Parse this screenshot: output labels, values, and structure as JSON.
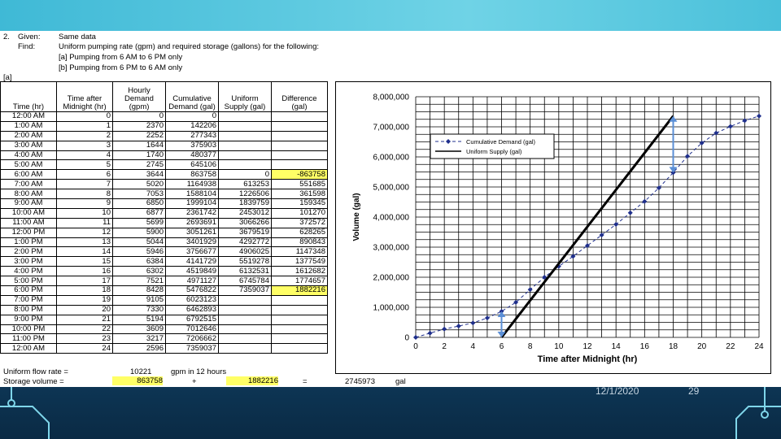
{
  "given": {
    "line1_num": "2.",
    "line1_label": "Given:",
    "line1_text": "Same data",
    "line2_label": "Find:",
    "line2_text": "Uniform pumping rate (gpm) and required storage (gallons) for the following:",
    "line3_text": "[a] Pumping from 6 AM to 6 PM only",
    "line4_text": "[b] Pumping from 6 PM to 6 AM only",
    "section_a": "[a]"
  },
  "table": {
    "headers": [
      "Time (hr)",
      "Time after Midnight (hr)",
      "Hourly Demand (gpm)",
      "Cumulative Demand (gal)",
      "Uniform Supply (gal)",
      "Difference (gal)"
    ],
    "rows": [
      [
        "12:00 AM",
        "0",
        "0",
        "0",
        "",
        ""
      ],
      [
        "1:00 AM",
        "1",
        "2370",
        "142206",
        "",
        ""
      ],
      [
        "2:00 AM",
        "2",
        "2252",
        "277343",
        "",
        ""
      ],
      [
        "3:00 AM",
        "3",
        "1644",
        "375903",
        "",
        ""
      ],
      [
        "4:00 AM",
        "4",
        "1740",
        "480377",
        "",
        ""
      ],
      [
        "5:00 AM",
        "5",
        "2745",
        "645106",
        "",
        ""
      ],
      [
        "6:00 AM",
        "6",
        "3644",
        "863758",
        "0",
        "-863758"
      ],
      [
        "7:00 AM",
        "7",
        "5020",
        "1164938",
        "613253",
        "551685"
      ],
      [
        "8:00 AM",
        "8",
        "7053",
        "1588104",
        "1226506",
        "361598"
      ],
      [
        "9:00 AM",
        "9",
        "6850",
        "1999104",
        "1839759",
        "159345"
      ],
      [
        "10:00 AM",
        "10",
        "6877",
        "2361742",
        "2453012",
        "101270"
      ],
      [
        "11:00 AM",
        "11",
        "5699",
        "2693691",
        "3066266",
        "372572"
      ],
      [
        "12:00 PM",
        "12",
        "5900",
        "3051261",
        "3679519",
        "628265"
      ],
      [
        "1:00 PM",
        "13",
        "5044",
        "3401929",
        "4292772",
        "890843"
      ],
      [
        "2:00 PM",
        "14",
        "5946",
        "3756677",
        "4906025",
        "1147348"
      ],
      [
        "3:00 PM",
        "15",
        "6384",
        "4141729",
        "5519278",
        "1377549"
      ],
      [
        "4:00 PM",
        "16",
        "6302",
        "4519849",
        "6132531",
        "1612682"
      ],
      [
        "5:00 PM",
        "17",
        "7521",
        "4971127",
        "6745784",
        "1774657"
      ],
      [
        "6:00 PM",
        "18",
        "8428",
        "5476822",
        "7359037",
        "1882216"
      ],
      [
        "7:00 PM",
        "19",
        "9105",
        "6023123",
        "",
        ""
      ],
      [
        "8:00 PM",
        "20",
        "7330",
        "6462893",
        "",
        ""
      ],
      [
        "9:00 PM",
        "21",
        "5194",
        "6792515",
        "",
        ""
      ],
      [
        "10:00 PM",
        "22",
        "3609",
        "7012646",
        "",
        ""
      ],
      [
        "11:00 PM",
        "23",
        "3217",
        "7206662",
        "",
        ""
      ],
      [
        "12:00 AM",
        "24",
        "2596",
        "7359037",
        "",
        ""
      ]
    ]
  },
  "footer": {
    "flow_label": "Uniform flow rate =",
    "flow_value": "10221",
    "flow_unit": "gpm in 12 hours",
    "storage_label": "Storage volume =",
    "storage_v1": "863758",
    "plus_sign": "+",
    "storage_v2": "1882216",
    "equals": "=",
    "storage_total": "2745973",
    "storage_unit": "gal"
  },
  "chart_data": {
    "type": "line",
    "xlabel": "Time after Midnight (hr)",
    "ylabel": "Volume (gal)",
    "xlim": [
      0,
      24
    ],
    "ylim": [
      0,
      8000000
    ],
    "xticks": [
      "0",
      "2",
      "4",
      "6",
      "8",
      "10",
      "12",
      "14",
      "16",
      "18",
      "20",
      "22",
      "24"
    ],
    "yticks": [
      "0",
      "1,000,000",
      "2,000,000",
      "3,000,000",
      "4,000,000",
      "5,000,000",
      "6,000,000",
      "7,000,000",
      "8,000,000"
    ],
    "grid": true,
    "legend_position": "center-right",
    "series": [
      {
        "name": "Cumulative Demand (gal)",
        "x": [
          0,
          1,
          2,
          3,
          4,
          5,
          6,
          7,
          8,
          9,
          10,
          11,
          12,
          13,
          14,
          15,
          16,
          17,
          18,
          19,
          20,
          21,
          22,
          23,
          24
        ],
        "y": [
          0,
          142206,
          277343,
          375903,
          480377,
          645106,
          863758,
          1164938,
          1588104,
          1999104,
          2361742,
          2693691,
          3051261,
          3401929,
          3756677,
          4141729,
          4519849,
          4971127,
          5476822,
          6023123,
          6462893,
          6792515,
          7012646,
          7206662,
          7359037
        ],
        "color": "#1f2f8c"
      },
      {
        "name": "Uniform Supply (gal)",
        "x": [
          6,
          18
        ],
        "y": [
          0,
          7359037
        ],
        "color": "#000000"
      }
    ],
    "annotations": [
      {
        "x": 6,
        "y1": 0,
        "y2": 863758,
        "color": "#5b8fd6"
      },
      {
        "x": 18,
        "y1": 5476822,
        "y2": 7359037,
        "color": "#5b8fd6"
      }
    ]
  },
  "slide": {
    "date": "12/1/2020",
    "number": "29"
  }
}
